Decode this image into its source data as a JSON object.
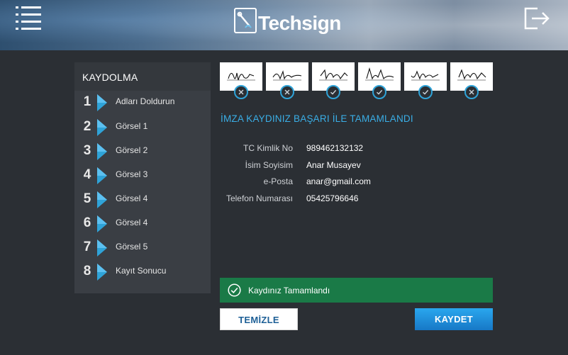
{
  "header": {
    "logo_text": "Techsign",
    "colors": {
      "accent": "#2fa3d8"
    }
  },
  "sidebar": {
    "title": "KAYDOLMA",
    "steps": [
      {
        "number": "1",
        "label": "Adları Doldurun"
      },
      {
        "number": "2",
        "label": "Görsel 1"
      },
      {
        "number": "3",
        "label": "Görsel 2"
      },
      {
        "number": "4",
        "label": "Görsel 3"
      },
      {
        "number": "5",
        "label": "Görsel 4"
      },
      {
        "number": "6",
        "label": "Görsel 4"
      },
      {
        "number": "7",
        "label": "Görsel 5"
      },
      {
        "number": "8",
        "label": "Kayıt Sonucu"
      }
    ]
  },
  "signatures": [
    {
      "status": "rejected"
    },
    {
      "status": "rejected"
    },
    {
      "status": "accepted"
    },
    {
      "status": "accepted"
    },
    {
      "status": "accepted"
    },
    {
      "status": "rejected"
    }
  ],
  "result": {
    "title": "İMZA KAYDINIZ BAŞARI İLE TAMAMLANDI",
    "fields": [
      {
        "label": "TC Kimlik No",
        "value": "989462132132"
      },
      {
        "label": "İsim Soyisim",
        "value": "Anar Musayev"
      },
      {
        "label": "e-Posta",
        "value": "anar@gmail.com"
      },
      {
        "label": "Telefon Numarası",
        "value": "05425796646"
      }
    ]
  },
  "status": {
    "message": "Kaydınız Tamamlandı",
    "color": "#1a7a47"
  },
  "buttons": {
    "clear_label": "TEMİZLE",
    "save_label": "KAYDET"
  }
}
